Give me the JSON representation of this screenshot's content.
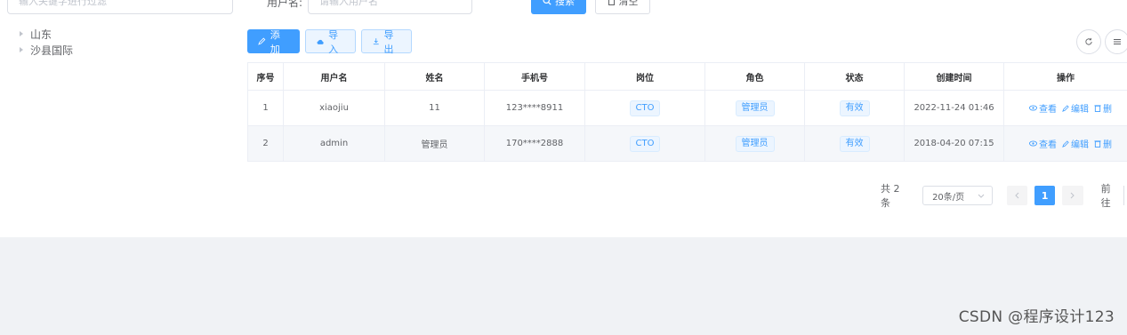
{
  "tree": {
    "filter_placeholder": "输入关键字进行过滤",
    "nodes": [
      {
        "label": "山东"
      },
      {
        "label": "沙县国际"
      }
    ]
  },
  "search": {
    "label": "用户名:",
    "placeholder": "请输入用户名",
    "search_button": "搜索",
    "reset_button": "清空"
  },
  "toolbar": {
    "add": "添加",
    "import": "导入",
    "export": "导出"
  },
  "table": {
    "columns": [
      "序号",
      "用户名",
      "姓名",
      "手机号",
      "岗位",
      "角色",
      "状态",
      "创建时间",
      "操作"
    ],
    "rows": [
      {
        "index": "1",
        "username": "xiaojiu",
        "name": "11",
        "phone": "123****8911",
        "post": "CTO",
        "role": "管理员",
        "status": "有效",
        "created": "2022-11-24 01:46"
      },
      {
        "index": "2",
        "username": "admin",
        "name": "管理员",
        "phone": "170****2888",
        "post": "CTO",
        "role": "管理员",
        "status": "有效",
        "created": "2018-04-20 07:15"
      }
    ],
    "actions": {
      "view": "查看",
      "edit": "编辑",
      "delete": "删"
    }
  },
  "pagination": {
    "total": "共 2 条",
    "page_size": "20条/页",
    "current_page": "1",
    "jump_label": "前往"
  },
  "watermark": "CSDN @程序设计123",
  "colors": {
    "primary": "#409eff",
    "background": "#f0f2f5"
  }
}
